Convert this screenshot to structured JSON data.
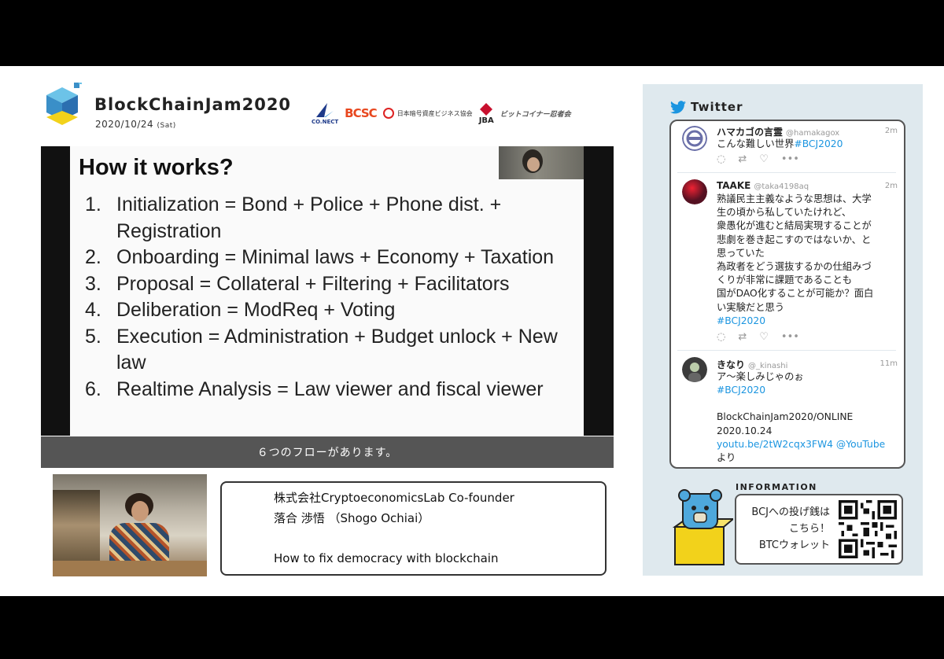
{
  "header": {
    "title": "BlockChainJam2020",
    "date": "2020/10/24",
    "day": "(Sat)",
    "sponsors": [
      "CO.NECT",
      "BCSC",
      "日本暗号資産ビジネス協会",
      "JBA",
      "ビットコイナー忍者会"
    ]
  },
  "slide": {
    "title": "How it works?",
    "items": [
      {
        "num": "1.",
        "text": "Initialization = Bond + Police + Phone dist. + Registration"
      },
      {
        "num": "2.",
        "text": "Onboarding = Minimal laws + Economy + Taxation"
      },
      {
        "num": "3.",
        "text": "Proposal = Collateral + Filtering + Facilitators"
      },
      {
        "num": "4.",
        "text": "Deliberation = ModReq + Voting"
      },
      {
        "num": "5.",
        "text": "Execution = Administration + Budget unlock + New law"
      },
      {
        "num": "6.",
        "text": "Realtime Analysis = Law viewer and fiscal viewer"
      }
    ],
    "subtitle": "６つのフローがあります。"
  },
  "speaker": {
    "company": "株式会社CryptoeconomicsLab Co-founder",
    "name": "落合 渉悟 （Shogo Ochiai）",
    "talk": "How to fix democracy with blockchain"
  },
  "twitter": {
    "heading": "Twitter",
    "tweets": [
      {
        "name": "ハマカゴの言霊",
        "handle": "@hamakagox",
        "time": "2m",
        "text": "こんな難しい世界",
        "hashtag": "#BCJ2020"
      },
      {
        "name": "TAAKE",
        "handle": "@taka4198aq",
        "time": "2m",
        "lines": [
          "熟議民主主義なような思想は、大学",
          "生の頃から私していたけれど、",
          "衆愚化が進むと結局実現することが",
          "悲劇を巻き起こすのではないか、と",
          "思っていた",
          "為政者をどう選抜するかの仕組みづ",
          "くりが非常に課題であることも",
          "国がDAO化することが可能か？面白",
          "い実験だと思う"
        ],
        "hashtag": "#BCJ2020"
      },
      {
        "name": "きなり",
        "handle": "@_kinashi",
        "time": "11m",
        "text": "ア〜楽しみじゃのぉ",
        "hashtag": "#BCJ2020",
        "extra1": "BlockChainJam2020/ONLINE",
        "extra2": "2020.10.24",
        "link": "youtu.be/2tW2cqx3FW4 @YouTube",
        "extra3": "より"
      }
    ]
  },
  "info": {
    "label": "INFORMATION",
    "line1": "BCJへの投げ銭は",
    "line2": "こちら！",
    "line3": "BTCウォレット"
  },
  "colors": {
    "accent": "#1b95e0",
    "panel": "#dfe9ee",
    "subtitle_bar": "#555555"
  }
}
